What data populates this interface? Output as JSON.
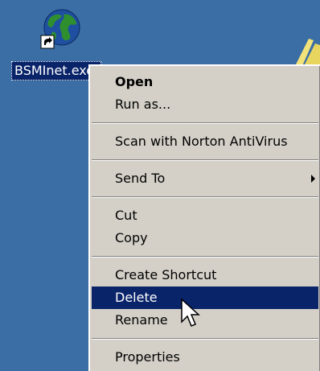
{
  "desktop": {
    "icon": {
      "label": "BSMInet.exe",
      "icon_name": "globe-shortcut-icon",
      "overlay_icon": "shortcut-arrow-icon"
    }
  },
  "context_menu": {
    "items": [
      {
        "label": "Open",
        "default": true
      },
      {
        "label": "Run as..."
      },
      {
        "label": "Scan with Norton AntiVirus"
      },
      {
        "label": "Send To",
        "submenu": true
      },
      {
        "label": "Cut"
      },
      {
        "label": "Copy"
      },
      {
        "label": "Create Shortcut"
      },
      {
        "label": "Delete",
        "highlighted": true
      },
      {
        "label": "Rename"
      },
      {
        "label": "Properties"
      }
    ]
  },
  "colors": {
    "desktop_background": "#3a6ea5",
    "menu_background": "#d4d0c8",
    "selection": "#0a246a",
    "globe_land": "#2f8f2f",
    "globe_sea": "#1f4fa0"
  }
}
